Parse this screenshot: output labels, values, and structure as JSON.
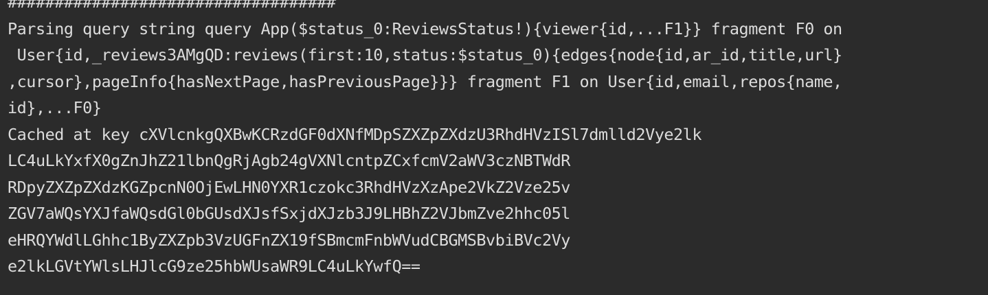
{
  "terminal": {
    "lines": [
      "###################################",
      "Parsing query string query App($status_0:ReviewsStatus!){viewer{id,...F1}} fragment F0 on",
      " User{id,_reviews3AMgQD:reviews(first:10,status:$status_0){edges{node{id,ar_id,title,url}",
      ",cursor},pageInfo{hasNextPage,hasPreviousPage}}} fragment F1 on User{id,email,repos{name,",
      "id},...F0}",
      "Cached at key cXVlcnkgQXBwKCRzdGF0dXNfMDpSZXZpZXdzU3RhdHVzISl7dmlld2Vye2lk",
      "LC4uLkYxfX0gZnJhZ21lbnQgRjAgb24gVXNlcntpZCxfcmV2aWV3czNBTWdR",
      "RDpyZXZpZXdzKGZpcnN0OjEwLHN0YXR1czokc3RhdHVzXzApe2VkZ2Vze25v",
      "ZGV7aWQsYXJfaWQsdGl0bGUsdXJsfSxjdXJzb3J9LHBhZ2VJbmZve2hhc05l",
      "eHRQYWdlLGhhc1ByZXZpb3VzUGFnZX19fSBmcmFnbWVudCBGMSBvbiBVc2Vy",
      "e2lkLGVtYWlsLHJlcG9ze25hbWUsaWR9LC4uLkYwfQ=="
    ]
  }
}
